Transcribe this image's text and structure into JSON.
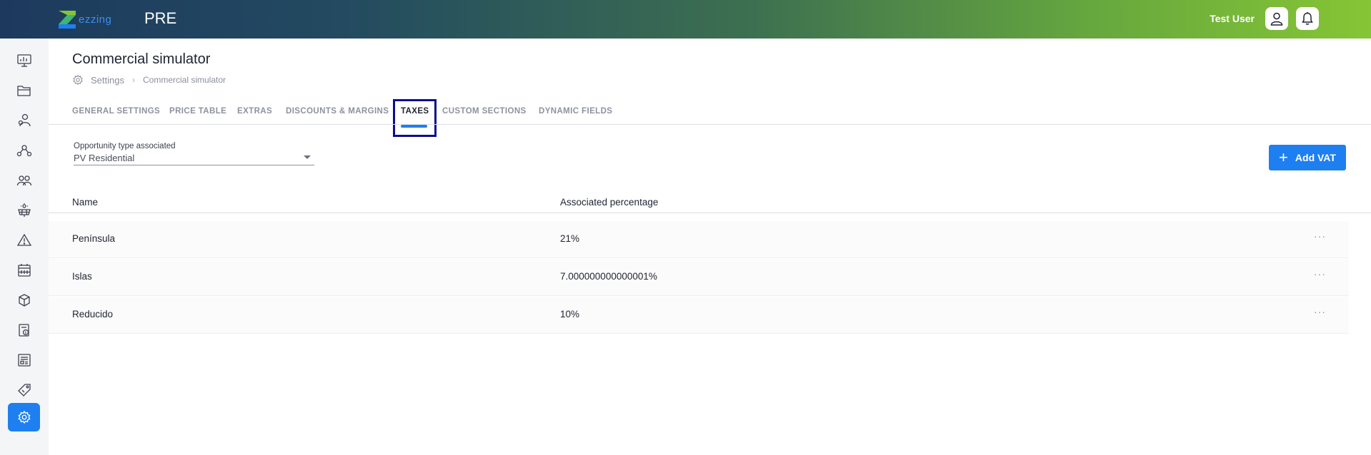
{
  "header": {
    "logo_text": "ezzing",
    "environment": "PRE",
    "user_name": "Test User",
    "icons": [
      "user-icon",
      "bell-icon"
    ],
    "colors": {
      "gradient_start": "#1d3a5e",
      "gradient_end": "#86c535"
    }
  },
  "sidebar": {
    "items": [
      {
        "icon": "dashboard-icon"
      },
      {
        "icon": "folder-icon"
      },
      {
        "icon": "contacts-icon"
      },
      {
        "icon": "network-icon"
      },
      {
        "icon": "team-icon"
      },
      {
        "icon": "solar-panel-icon"
      },
      {
        "icon": "alert-icon"
      },
      {
        "icon": "calendar-icon"
      },
      {
        "icon": "box-icon"
      },
      {
        "icon": "invoice-icon"
      },
      {
        "icon": "documents-icon"
      },
      {
        "icon": "tag-icon"
      },
      {
        "icon": "settings-icon",
        "active": true
      }
    ],
    "accent": "#1e7ff0"
  },
  "page": {
    "title": "Commercial simulator",
    "breadcrumb": {
      "parent": "Settings",
      "separator": "›",
      "current": "Commercial simulator"
    }
  },
  "tabs": [
    {
      "label": "GENERAL SETTINGS"
    },
    {
      "label": "PRICE TABLE"
    },
    {
      "label": "EXTRAS"
    },
    {
      "label": "DISCOUNTS & MARGINS"
    },
    {
      "label": "TAXES",
      "active": true
    },
    {
      "label": "CUSTOM SECTIONS"
    },
    {
      "label": "DYNAMIC FIELDS"
    }
  ],
  "opportunity_field": {
    "label": "Opportunity type associated",
    "value": "PV Residential"
  },
  "add_button": {
    "label": "Add VAT"
  },
  "table": {
    "columns": [
      "Name",
      "Associated percentage"
    ],
    "rows": [
      {
        "name": "Península",
        "percentage": "21%",
        "menu": "···"
      },
      {
        "name": "Islas",
        "percentage": "7.000000000000001%",
        "menu": "···"
      },
      {
        "name": "Reducido",
        "percentage": "10%",
        "menu": "···"
      }
    ]
  }
}
